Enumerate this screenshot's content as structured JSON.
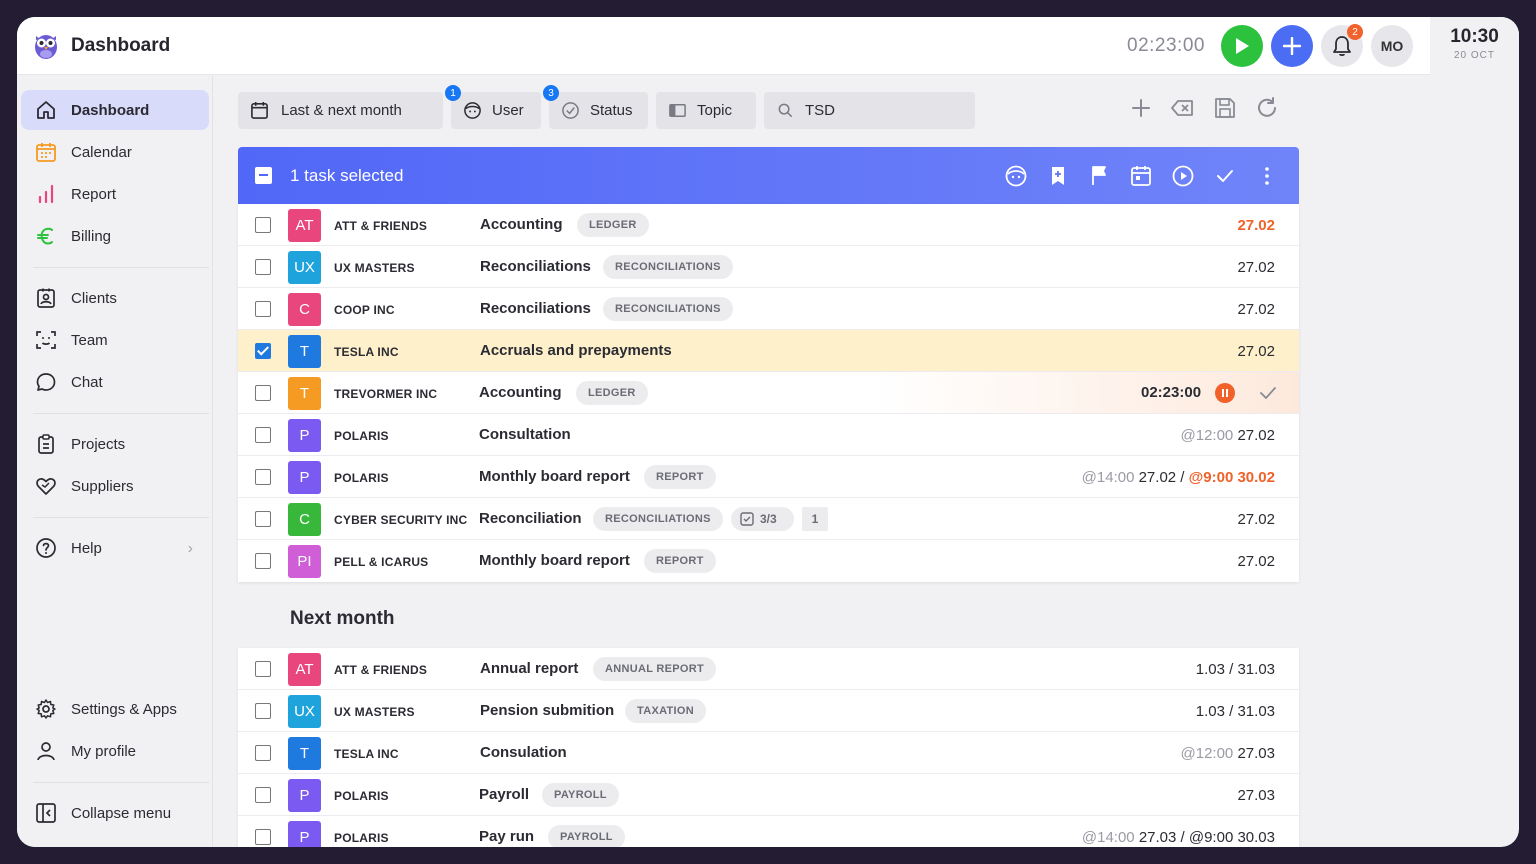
{
  "header": {
    "title": "Dashboard",
    "timer": "02:23:00",
    "avatar_initials": "MO",
    "notification_count": "2",
    "clock_time": "10:30",
    "clock_date": "20 OCT"
  },
  "sidebar": {
    "items": [
      {
        "label": "Dashboard",
        "icon": "home-icon",
        "active": true
      },
      {
        "label": "Calendar",
        "icon": "calendar-icon"
      },
      {
        "label": "Report",
        "icon": "bar-chart-icon"
      },
      {
        "label": "Billing",
        "icon": "euro-icon"
      },
      {
        "label": "Clients",
        "icon": "contact-card-icon"
      },
      {
        "label": "Team",
        "icon": "face-scan-icon"
      },
      {
        "label": "Chat",
        "icon": "chat-bubble-icon"
      },
      {
        "label": "Projects",
        "icon": "clipboard-icon"
      },
      {
        "label": "Suppliers",
        "icon": "handshake-heart-icon"
      },
      {
        "label": "Help",
        "icon": "help-circle-icon"
      },
      {
        "label": "Settings & Apps",
        "icon": "settings-gear-icon"
      },
      {
        "label": "My profile",
        "icon": "user-icon"
      },
      {
        "label": "Collapse menu",
        "icon": "collapse-sidebar-icon"
      }
    ]
  },
  "filters": {
    "date_range": "Last & next month",
    "user": "User",
    "user_badge": "1",
    "status": "Status",
    "status_badge": "3",
    "topic": "Topic",
    "search_value": "TSD"
  },
  "selection": {
    "text": "1 task selected"
  },
  "tasks_current": [
    {
      "initials": "AT",
      "color": "#e8467c",
      "client": "ATT & FRIENDS",
      "task": "Accounting",
      "tag": "LEDGER",
      "date": "27.02",
      "date_style": "orange"
    },
    {
      "initials": "UX",
      "color": "#1fa3dc",
      "client": "UX MASTERS",
      "task": "Reconciliations",
      "tag": "RECONCILIATIONS",
      "date": "27.02"
    },
    {
      "initials": "C",
      "color": "#e8467c",
      "client": "COOP INC",
      "task": "Reconciliations",
      "tag": "RECONCILIATIONS",
      "date": "27.02"
    },
    {
      "initials": "T",
      "color": "#1f7ae0",
      "client": "TESLA INC",
      "task": "Accruals and prepayments",
      "tag": "",
      "date": "27.02",
      "checked": true
    },
    {
      "initials": "T",
      "color": "#f59a23",
      "client": "TREVORMER INC",
      "task": "Accounting",
      "tag": "LEDGER",
      "running": true,
      "run_time": "02:23:00"
    },
    {
      "initials": "P",
      "color": "#7a5af0",
      "client": "POLARIS",
      "task": "Consultation",
      "tag": "",
      "time": "@12:00",
      "date": "27.02"
    },
    {
      "initials": "P",
      "color": "#7a5af0",
      "client": "POLARIS",
      "task": "Monthly board report",
      "tag": "REPORT",
      "time": "@14:00",
      "date": "27.02 /",
      "date2": "@9:00 30.02"
    },
    {
      "initials": "C",
      "color": "#38b83b",
      "client": "CYBER SECURITY INC",
      "task": "Reconciliation",
      "tag": "RECONCILIATIONS",
      "subtasks": "3/3",
      "comments": "1",
      "date": "27.02"
    },
    {
      "initials": "PI",
      "color": "#d05ed6",
      "client": "PELL & ICARUS",
      "task": "Monthly board report",
      "tag": "REPORT",
      "date": "27.02"
    }
  ],
  "next_month": {
    "title": "Next month",
    "tasks": [
      {
        "initials": "AT",
        "color": "#e8467c",
        "client": "ATT & FRIENDS",
        "task": "Annual report",
        "tag": "ANNUAL REPORT",
        "date": "1.03 / 31.03"
      },
      {
        "initials": "UX",
        "color": "#1fa3dc",
        "client": "UX MASTERS",
        "task": "Pension submition",
        "tag": "TAXATION",
        "date": "1.03 / 31.03"
      },
      {
        "initials": "T",
        "color": "#1f7ae0",
        "client": "TESLA INC",
        "task": "Consulation",
        "tag": "",
        "time": "@12:00",
        "date": "27.03"
      },
      {
        "initials": "P",
        "color": "#7a5af0",
        "client": "POLARIS",
        "task": "Payroll",
        "tag": "PAYROLL",
        "date": "27.03"
      },
      {
        "initials": "P",
        "color": "#7a5af0",
        "client": "POLARIS",
        "task": "Pay run",
        "tag": "PAYROLL",
        "time": "@14:00",
        "date": "27.03 / @9:00 30.03"
      }
    ]
  }
}
